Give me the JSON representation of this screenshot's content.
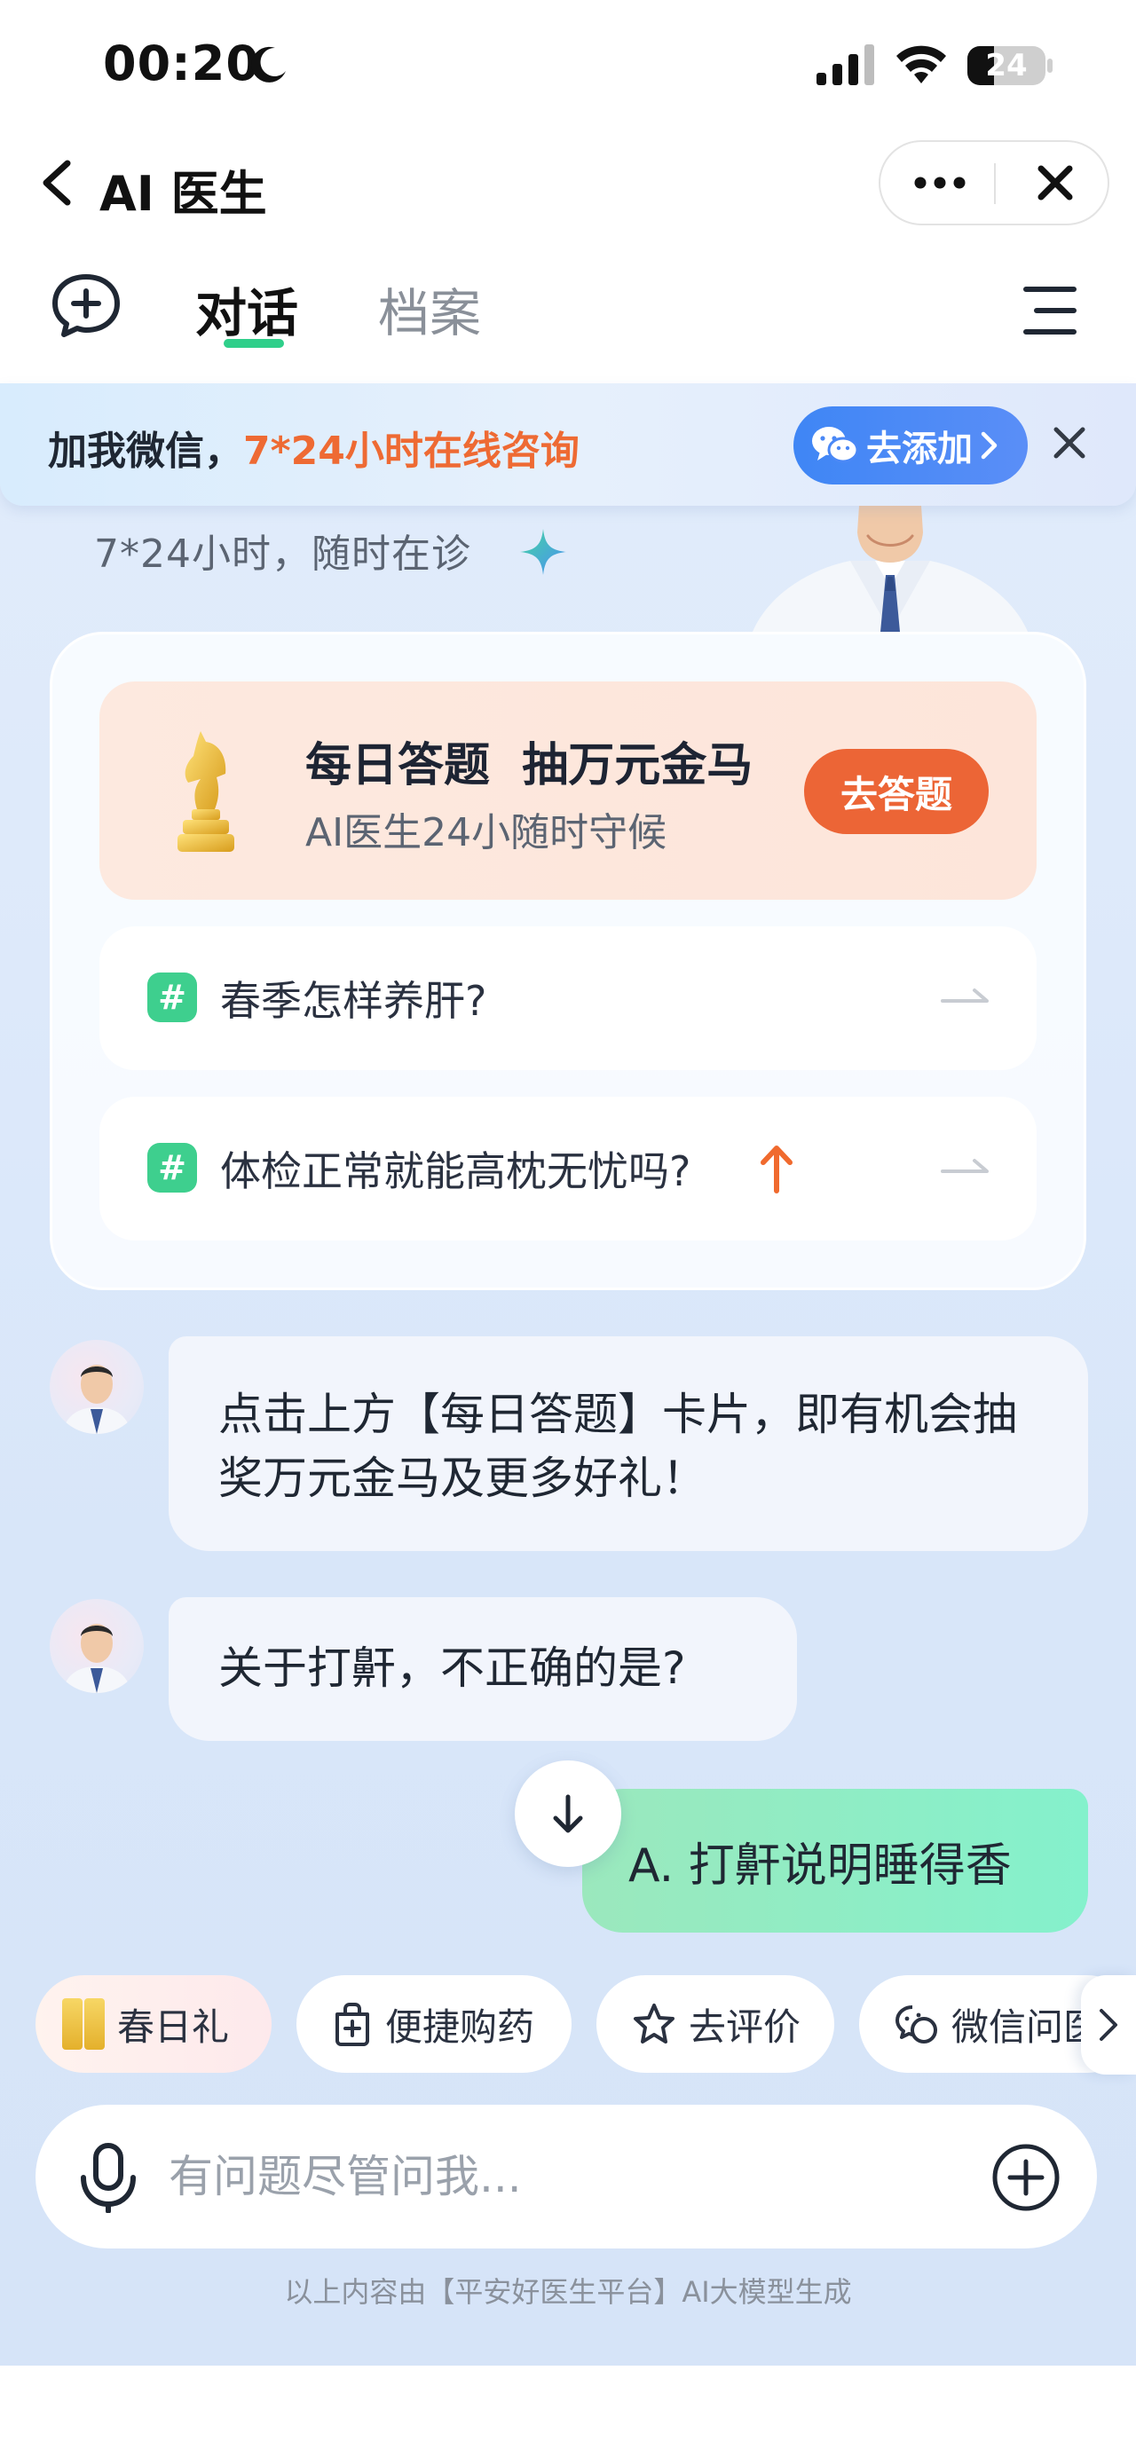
{
  "status_bar": {
    "time": "00:20",
    "battery": "24"
  },
  "nav": {
    "title": "AI 医生"
  },
  "tabs": [
    {
      "label": "对话"
    },
    {
      "label": "档案"
    }
  ],
  "banner": {
    "text_prefix": "加我微信，",
    "text_highlight": "7*24小时在线咨询",
    "button_label": "去添加"
  },
  "hero": {
    "subtitle": "7*24小时，随时在诊"
  },
  "quiz_card": {
    "title": "每日答题  抽万元金马",
    "subtitle": "AI医生24小随时守候",
    "button_label": "去答题",
    "questions": [
      {
        "text": "春季怎样养肝?"
      },
      {
        "text": "体检正常就能高枕无忧吗?"
      }
    ]
  },
  "messages": [
    {
      "from": "doctor",
      "text": "点击上方【每日答题】卡片，即有机会抽奖万元金马及更多好礼！"
    },
    {
      "from": "doctor",
      "text": "关于打鼾，不正确的是?"
    },
    {
      "from": "user",
      "text": "A. 打鼾说明睡得香"
    }
  ],
  "quick_actions": [
    {
      "label": "春日礼",
      "icon": "gold-bar-icon"
    },
    {
      "label": "便捷购药",
      "icon": "medicine-bag-icon"
    },
    {
      "label": "去评价",
      "icon": "star-icon"
    },
    {
      "label": "微信问医",
      "icon": "wechat-doctor-icon"
    }
  ],
  "input": {
    "placeholder": "有问题尽管问我..."
  },
  "disclaimer": "以上内容由【平安好医生平台】AI大模型生成",
  "colors": {
    "accent_green": "#2fcf8a",
    "accent_orange": "#ec6536",
    "brand_blue": "#3f86f5"
  }
}
